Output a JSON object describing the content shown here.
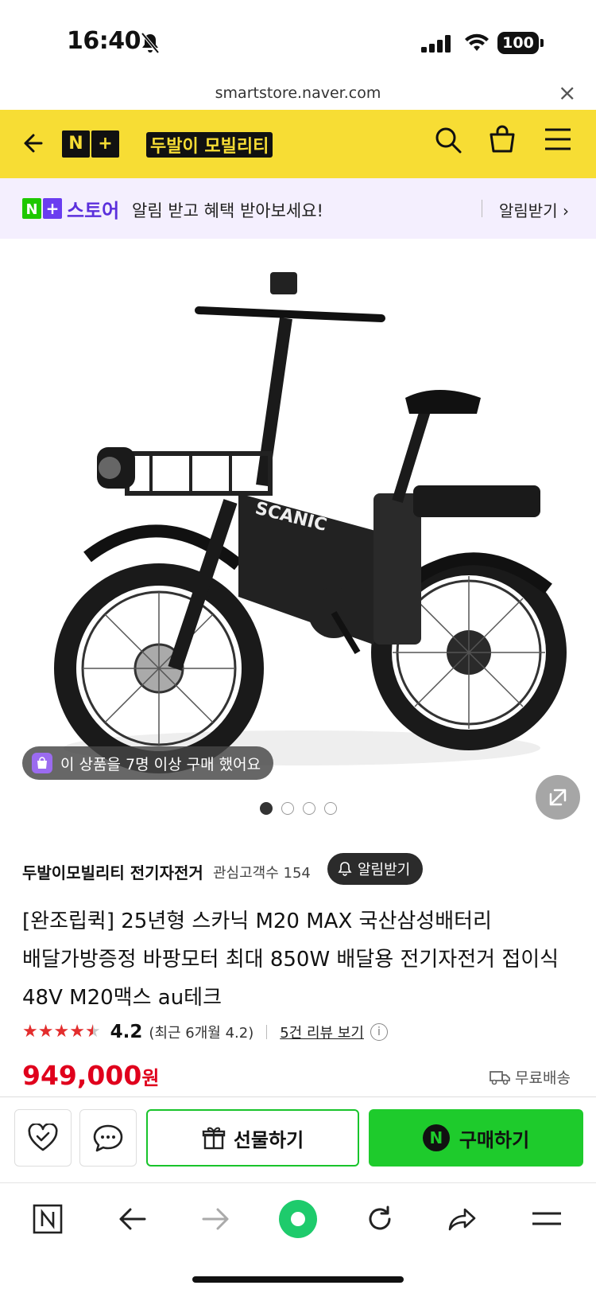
{
  "status_bar": {
    "time": "16:40",
    "battery": "100"
  },
  "url_bar": {
    "url": "smartstore.naver.com",
    "close": "×"
  },
  "header": {
    "nplus_n": "N",
    "nplus_plus": "+",
    "shop_name": "두발이 모빌리티"
  },
  "banner": {
    "store_label": "스토어",
    "message": "알림 받고 혜택 받아보세요!",
    "cta": "알림받기 ›"
  },
  "product_image": {
    "buyer_notice": "이 상품을 7명 이상 구매 했어요",
    "dots_total": 4,
    "dots_active": 1
  },
  "product": {
    "seller": "두발이모빌리티 전기자전거",
    "interest": "관심고객수 154",
    "alarm_button": "알림받기",
    "title": "[완조립퀵] 25년형 스카닉 M20 MAX 국산삼성배터리 배달가방증정 바팡모터 최대 850W 배달용 전기자전거 접이식 48V M20맥스 au테크",
    "rating": "4.2",
    "rating_recent": "(최근 6개월 4.2)",
    "review_link": "5건 리뷰 보기",
    "price": "949,000",
    "price_unit": "원",
    "shipping": "무료배송"
  },
  "purchase_bar": {
    "gift_label": "선물하기",
    "buy_label": "구매하기",
    "buy_n": "N"
  },
  "colors": {
    "brand_yellow": "#f7dd34",
    "naver_green": "#1ecb2c",
    "price_red": "#e0001c",
    "store_purple": "#5b2fdc"
  }
}
